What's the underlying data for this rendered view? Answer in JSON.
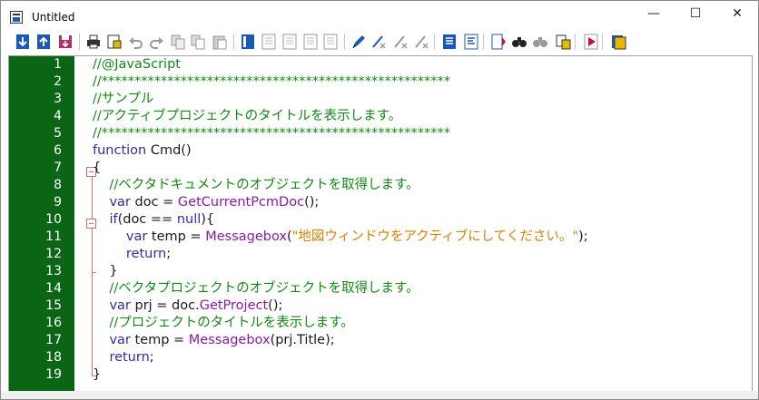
{
  "window": {
    "title": "Untitled",
    "controls": {
      "minimize": "—",
      "maximize": "☐",
      "close": "✕"
    }
  },
  "toolbar": {
    "buttons": [
      "import-icon",
      "export-icon",
      "save-icon",
      "print-icon",
      "print-preview-icon",
      "undo-icon",
      "redo-icon",
      "cut-icon",
      "copy-icon",
      "paste-icon",
      "list-icon",
      "bookmark-icon",
      "bookmark-next-icon",
      "bookmark-prev-icon",
      "bookmark-clear-icon",
      "pen-icon",
      "breakpoint-icon",
      "breakpoint-toggle-icon",
      "breakpoint-clear-icon",
      "indent-icon",
      "outdent-icon",
      "script-icon",
      "find-icon",
      "find-next-icon",
      "replace-icon",
      "run-icon",
      "help-icon"
    ]
  },
  "editor": {
    "line_numbers": [
      "1",
      "2",
      "3",
      "4",
      "5",
      "6",
      "7",
      "8",
      "9",
      "10",
      "11",
      "12",
      "13",
      "14",
      "15",
      "16",
      "17",
      "18",
      "19"
    ],
    "lines": [
      [
        {
          "t": "//@JavaScript",
          "c": "comment"
        }
      ],
      [
        {
          "t": "//*****************************************************",
          "c": "comment"
        }
      ],
      [
        {
          "t": "//サンプル",
          "c": "comment"
        }
      ],
      [
        {
          "t": "//アクティブプロジェクトのタイトルを表示します。",
          "c": "comment"
        }
      ],
      [
        {
          "t": "//*****************************************************",
          "c": "comment"
        }
      ],
      [
        {
          "t": "function",
          "c": "kw"
        },
        {
          "t": " Cmd()",
          "c": "plain"
        }
      ],
      [
        {
          "t": "{",
          "c": "plain"
        }
      ],
      [
        {
          "t": "    //ベクタドキュメントのオブジェクトを取得します。",
          "c": "comment"
        }
      ],
      [
        {
          "t": "    ",
          "c": "plain"
        },
        {
          "t": "var",
          "c": "kw"
        },
        {
          "t": " doc = ",
          "c": "plain"
        },
        {
          "t": "GetCurrentPcmDoc",
          "c": "func"
        },
        {
          "t": "();",
          "c": "plain"
        }
      ],
      [
        {
          "t": "    ",
          "c": "plain"
        },
        {
          "t": "if",
          "c": "kw"
        },
        {
          "t": "(doc == ",
          "c": "plain"
        },
        {
          "t": "null",
          "c": "kw"
        },
        {
          "t": "){",
          "c": "plain"
        }
      ],
      [
        {
          "t": "        ",
          "c": "plain"
        },
        {
          "t": "var",
          "c": "kw"
        },
        {
          "t": " temp = ",
          "c": "plain"
        },
        {
          "t": "Messagebox",
          "c": "func"
        },
        {
          "t": "(",
          "c": "plain"
        },
        {
          "t": "\"地図ウィンドウをアクティブにしてください。\"",
          "c": "str"
        },
        {
          "t": ");",
          "c": "plain"
        }
      ],
      [
        {
          "t": "        ",
          "c": "plain"
        },
        {
          "t": "return",
          "c": "kw"
        },
        {
          "t": ";",
          "c": "plain"
        }
      ],
      [
        {
          "t": "    }",
          "c": "plain"
        }
      ],
      [
        {
          "t": "    //ベクタプロジェクトのオブジェクトを取得します。",
          "c": "comment"
        }
      ],
      [
        {
          "t": "    ",
          "c": "plain"
        },
        {
          "t": "var",
          "c": "kw"
        },
        {
          "t": " prj = doc.",
          "c": "plain"
        },
        {
          "t": "GetProject",
          "c": "func"
        },
        {
          "t": "();",
          "c": "plain"
        }
      ],
      [
        {
          "t": "    //プロジェクトのタイトルを表示します。",
          "c": "comment"
        }
      ],
      [
        {
          "t": "    ",
          "c": "plain"
        },
        {
          "t": "var",
          "c": "kw"
        },
        {
          "t": " temp = ",
          "c": "plain"
        },
        {
          "t": "Messagebox",
          "c": "func"
        },
        {
          "t": "(prj.Title);",
          "c": "plain"
        }
      ],
      [
        {
          "t": "    ",
          "c": "plain"
        },
        {
          "t": "return",
          "c": "kw"
        },
        {
          "t": ";",
          "c": "plain"
        }
      ],
      [
        {
          "t": "}",
          "c": "plain"
        }
      ]
    ]
  },
  "colors": {
    "gutter": "#0a6614",
    "comment": "#138a13",
    "keyword": "#2c2cb0",
    "function": "#8a1aa6",
    "string": "#d48000",
    "fold": "#e07070"
  }
}
